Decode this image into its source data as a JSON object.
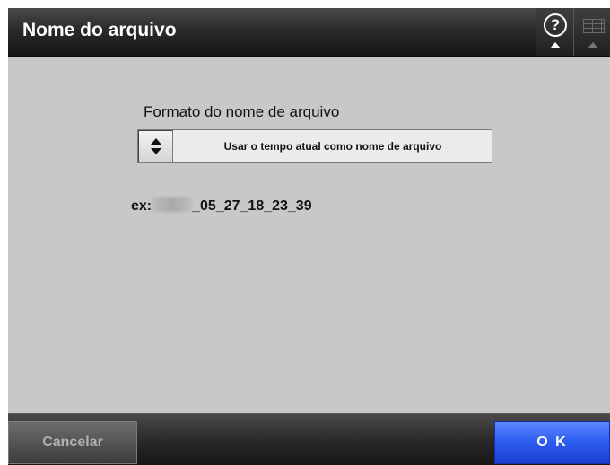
{
  "window": {
    "title": "Nome do arquivo"
  },
  "toolbar": {
    "help_icon": "question-circle-icon",
    "keyboard_icon": "keyboard-icon"
  },
  "main": {
    "format_label": "Formato do nome de arquivo",
    "format_select": {
      "value": "Usar o tempo atual como nome de arquivo",
      "spinner_icon": "up-down-arrows-icon"
    },
    "example": {
      "prefix": "ex:",
      "suffix": "_05_27_18_23_39"
    }
  },
  "footer": {
    "cancel_label": "Cancelar",
    "ok_label": "O K"
  },
  "colors": {
    "titlebar": "#2a2a2a",
    "background": "#c8c8c8",
    "ok_button": "#2c5cf0",
    "cancel_button": "#555555"
  }
}
